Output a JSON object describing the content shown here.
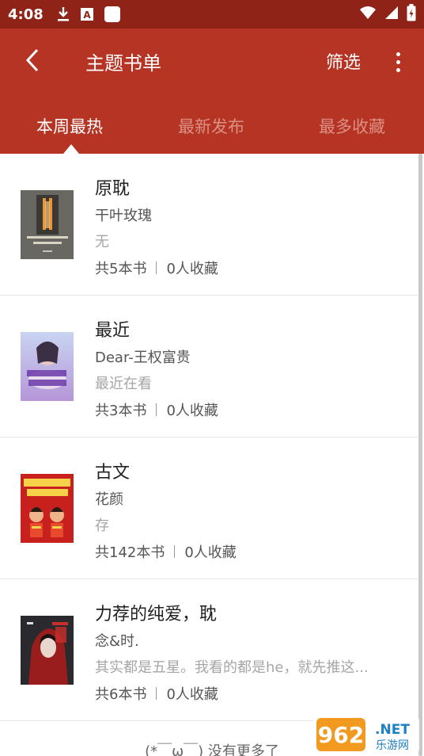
{
  "status_bar": {
    "time": "4:08",
    "icons": [
      "download-icon",
      "a-app-icon",
      "square-app-icon",
      "wifi-icon",
      "signal-icon",
      "battery-icon"
    ]
  },
  "app_bar": {
    "title": "主题书单",
    "filter_label": "筛选",
    "back_icon": "back-arrow-icon",
    "more_icon": "more-vert-icon"
  },
  "tabs": [
    {
      "label": "本周最热",
      "active": true
    },
    {
      "label": "最新发布",
      "active": false
    },
    {
      "label": "最多收藏",
      "active": false
    }
  ],
  "booklists": [
    {
      "name": "原耽",
      "author": "干叶玫瑰",
      "desc": "无",
      "books": "共5本书",
      "favs": "0人收藏"
    },
    {
      "name": "最近",
      "author": "Dear-王权富贵",
      "desc": "最近在看",
      "books": "共3本书",
      "favs": "0人收藏"
    },
    {
      "name": "古文",
      "author": "花颜",
      "desc": "存",
      "books": "共142本书",
      "favs": "0人收藏"
    },
    {
      "name": "力荐的纯爱，耽",
      "author": "念&时.",
      "desc": "其实都是五星。我看的都是he，就先推这...",
      "books": "共6本书",
      "favs": "0人收藏"
    }
  ],
  "footer": {
    "text": "(*￣ω￣) 没有更多了"
  },
  "watermark": {
    "brand": "962.NET",
    "subtitle": "乐游网"
  },
  "colors": {
    "status_bar": "#8f2318",
    "app_bar": "#b53424",
    "tab_inactive": "#dc8f83"
  }
}
